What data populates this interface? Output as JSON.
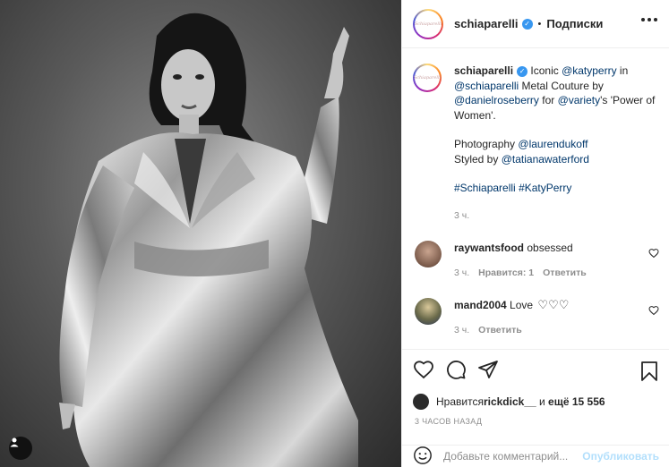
{
  "post": {
    "username": "schiaparelli",
    "dot": "•",
    "follow_label": "Подписки",
    "avatar_logo": "Schiaparelli"
  },
  "caption": {
    "username": "schiaparelli",
    "text_1": " Iconic ",
    "mention_1": "@katyperry",
    "text_2": " in ",
    "mention_2": "@schiaparelli",
    "text_3": " Metal Couture by ",
    "mention_3": "@danielroseberry",
    "text_4": " for ",
    "mention_4": "@variety",
    "text_5": "'s 'Power of Women'.",
    "photo_text": "Photography ",
    "photo_mention": "@laurendukoff",
    "styled_text": "Styled by ",
    "styled_mention": "@tatianawaterford",
    "hashtag_1": "#Schiaparelli",
    "hashtag_2": "#KatyPerry",
    "time": "3 ч."
  },
  "comments": [
    {
      "username": "raywantsfood",
      "text": "obsessed",
      "time": "3 ч.",
      "likes": "Нравится: 1",
      "reply": "Ответить",
      "avatar_color": "#a07a66"
    },
    {
      "username": "mand2004",
      "text": "Love",
      "time": "3 ч.",
      "likes": "",
      "reply": "Ответить",
      "avatar_color": "#3c4c6b"
    }
  ],
  "likes": {
    "prefix": "Нравится ",
    "user": "rickdick__",
    "middle": " и ",
    "others": "ещё 15 556"
  },
  "time_ago": "3 ЧАСОВ НАЗАД",
  "add_comment": {
    "placeholder": "Добавьте комментарий...",
    "publish": "Опубликовать"
  },
  "icons": {
    "like": "heart-icon",
    "comment": "comment-icon",
    "share": "share-icon",
    "save": "bookmark-icon",
    "emoji": "emoji-icon",
    "more": "more-options-icon",
    "user_tag": "user-tag-icon"
  },
  "colors": {
    "link": "#00376b",
    "verified": "#3897f0",
    "muted": "#8e8e8e",
    "publish_disabled": "#b2dffc"
  }
}
